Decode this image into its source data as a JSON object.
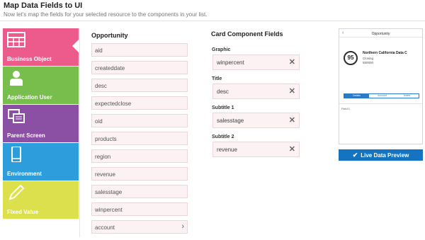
{
  "header": {
    "title": "Map Data Fields to UI",
    "subtitle": "Now let's map the fields for your selected resource to the components in your list."
  },
  "sources": [
    {
      "label": "Business Object",
      "icon": "table-icon",
      "color": "#ec5b8b"
    },
    {
      "label": "Application User",
      "icon": "user-icon",
      "color": "#78be4c"
    },
    {
      "label": "Parent Screen",
      "icon": "screens-icon",
      "color": "#8b4fa3"
    },
    {
      "label": "Environment",
      "icon": "phone-icon",
      "color": "#2d9edb"
    },
    {
      "label": "Fixed Value",
      "icon": "pencil-icon",
      "color": "#dbe04c"
    }
  ],
  "opportunity": {
    "title": "Opportunity",
    "fields": [
      "aid",
      "createddate",
      "desc",
      "expectedclose",
      "oid",
      "products",
      "region",
      "revenue",
      "salesstage",
      "winpercent",
      "account"
    ]
  },
  "card": {
    "title": "Card Component Fields",
    "slots": [
      {
        "label": "Graphic",
        "value": "winpercent"
      },
      {
        "label": "Title",
        "value": "desc"
      },
      {
        "label": "Subtitle 1",
        "value": "salesstage"
      },
      {
        "label": "Subtitle 2",
        "value": "revenue"
      }
    ]
  },
  "preview": {
    "screen_title": "Opportunity",
    "back_glyph": "‹",
    "score": "95",
    "line1": "Northern California Data C",
    "line2": "Closing",
    "line3": "550000",
    "tabs": [
      "Details",
      "Account",
      "Notes"
    ],
    "field_row": "Field 1"
  },
  "live_preview_label": "Live Data Preview",
  "colors": {
    "accent": "#1574c2",
    "field_bg": "#fcf2f3"
  }
}
